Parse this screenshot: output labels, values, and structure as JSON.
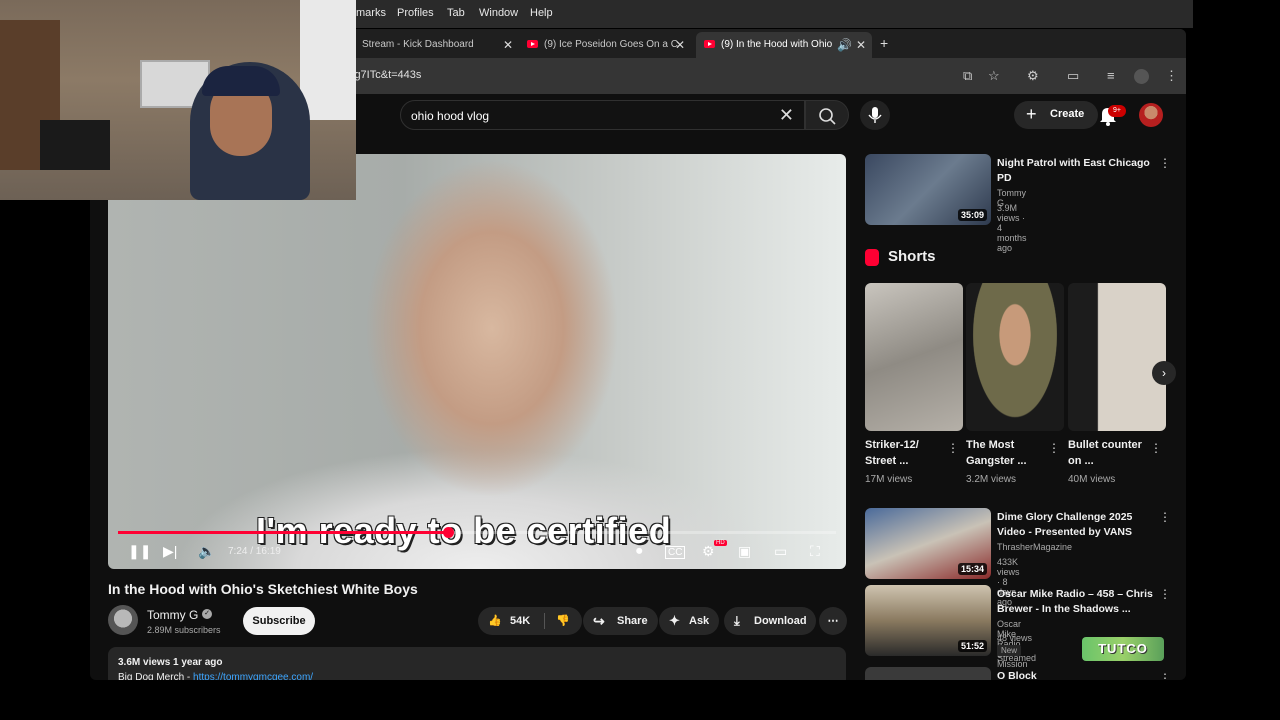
{
  "menubar": {
    "items": [
      "marks",
      "Profiles",
      "Tab",
      "Window",
      "Help"
    ]
  },
  "tabs": [
    {
      "label": "Stream - Kick Dashboard"
    },
    {
      "label": "(9) Ice Poseidon Goes On a C"
    },
    {
      "label": "(9) In the Hood with Ohio"
    }
  ],
  "address": {
    "url": "lg7ITc&t=443s"
  },
  "search": {
    "query": "ohio hood vlog"
  },
  "header": {
    "create_label": "Create",
    "notification_count": "9+"
  },
  "player": {
    "caption": "I'm ready to be certified",
    "time": "7:24 / 16:19",
    "progress_fraction": 0.46,
    "hd_badge": "HD"
  },
  "video": {
    "title": "In the Hood with Ohio's Sketchiest White Boys",
    "channel": "Tommy G",
    "subscribers": "2.89M subscribers",
    "subscribe_label": "Subscribe",
    "likes": "54K",
    "share_label": "Share",
    "ask_label": "Ask",
    "download_label": "Download",
    "desc_meta": "3.6M views  1 year ago",
    "desc_text": "Big Dog Merch - ",
    "desc_link": "https://tommygmcgee.com/"
  },
  "sidebar": {
    "top_video": {
      "title": "Night Patrol with East Chicago PD",
      "channel": "Tommy G",
      "meta": "3.9M views · 4 months ago",
      "duration": "35:09"
    },
    "shorts_heading": "Shorts",
    "shorts": [
      {
        "title": "Striker-12/ Street ...",
        "views": "17M views"
      },
      {
        "title": "The Most Gangster ...",
        "views": "3.2M views"
      },
      {
        "title": "Bullet counter on ...",
        "views": "40M views"
      }
    ],
    "videos": [
      {
        "title": "Dime Glory Challenge 2025 Video - Presented by VANS",
        "channel": "ThrasherMagazine",
        "meta": "433K views · 8 days ago",
        "duration": "15:34"
      },
      {
        "title": "Oscar Mike Radio – 458 – Chris Brewer - In the Shadows ...",
        "channel": "Oscar Mike Radio On Mission - Always",
        "meta": "48 views · Streamed",
        "duration": "51:52",
        "badge": "New"
      },
      {
        "title": "O Block"
      }
    ]
  },
  "overlay": {
    "logo_text": "TUTCO"
  },
  "colors": {
    "accent": "#ff0033",
    "background": "#0f0f0f",
    "chip": "#272727"
  }
}
